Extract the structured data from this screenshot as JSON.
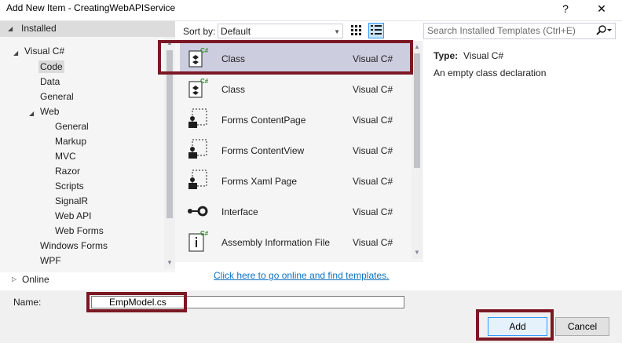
{
  "window": {
    "title": "Add New Item - CreatingWebAPIService",
    "help_label": "?",
    "close_label": "✕"
  },
  "tree": {
    "installed_label": "Installed",
    "visual_csharp_label": "Visual C#",
    "code_label": "Code",
    "data_label": "Data",
    "general_label": "General",
    "web_label": "Web",
    "web_children": [
      "General",
      "Markup",
      "MVC",
      "Razor",
      "Scripts",
      "SignalR",
      "Web API",
      "Web Forms"
    ],
    "windows_forms_label": "Windows Forms",
    "wpf_label": "WPF",
    "online_label": "Online"
  },
  "toolbar": {
    "sort_by_label": "Sort by:",
    "sort_value": "Default",
    "search_placeholder": "Search Installed Templates (Ctrl+E)"
  },
  "templates": [
    {
      "name": "Class",
      "lang": "Visual C#",
      "icon": "class-icon",
      "selected": true
    },
    {
      "name": "Class",
      "lang": "Visual C#",
      "icon": "class-icon",
      "selected": false
    },
    {
      "name": "Forms ContentPage",
      "lang": "Visual C#",
      "icon": "forms-page-icon",
      "selected": false
    },
    {
      "name": "Forms ContentView",
      "lang": "Visual C#",
      "icon": "forms-page-icon",
      "selected": false
    },
    {
      "name": "Forms Xaml Page",
      "lang": "Visual C#",
      "icon": "forms-page-icon",
      "selected": false
    },
    {
      "name": "Interface",
      "lang": "Visual C#",
      "icon": "interface-icon",
      "selected": false
    },
    {
      "name": "Assembly Information File",
      "lang": "Visual C#",
      "icon": "assembly-info-icon",
      "selected": false
    }
  ],
  "details": {
    "type_label": "Type:",
    "type_value": "Visual C#",
    "description": "An empty class declaration"
  },
  "online_link": "Click here to go online and find templates.",
  "footer": {
    "name_label": "Name:",
    "name_value": "EmpModel.cs",
    "add_label": "Add",
    "cancel_label": "Cancel"
  },
  "colors": {
    "highlight_border": "#7b1824",
    "selection": "#cdcde0",
    "link": "#0e70c0",
    "csharp_green": "#388a34"
  }
}
